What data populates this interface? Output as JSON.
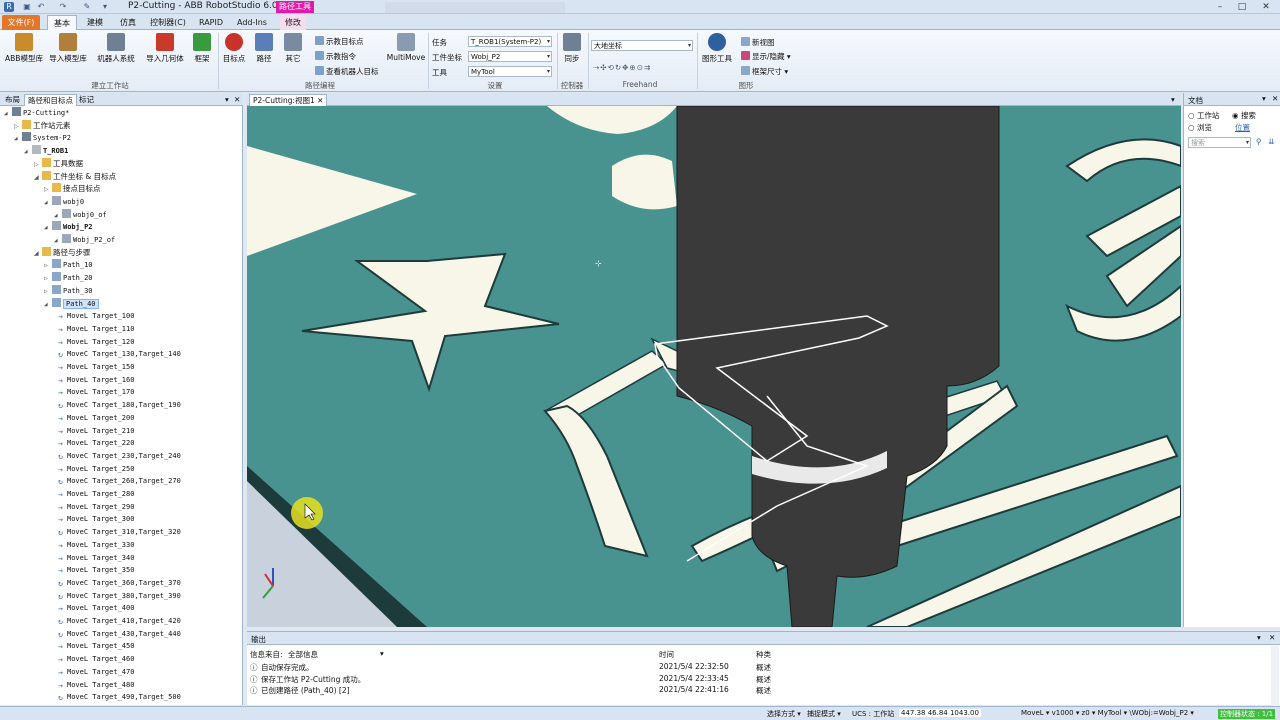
{
  "window": {
    "title": "P2-Cutting - ABB RobotStudio 6.08",
    "context_tab": "路径工具"
  },
  "tabs": [
    "文件(F)",
    "基本",
    "建模",
    "仿真",
    "控制器(C)",
    "RAPID",
    "Add-Ins",
    "修改"
  ],
  "ribbon": {
    "buttons": [
      "ABB模型库",
      "导入模型库",
      "机器人系统",
      "导入几何体",
      "框架",
      "目标点",
      "路径",
      "其它",
      "MultiMove",
      "同步",
      "图形工具"
    ],
    "small_items": [
      "示教目标点",
      "示教指令",
      "查看机器人目标",
      "新视图",
      "显示/隐藏",
      "框架尺寸"
    ],
    "groups": [
      "建立工作站",
      "路径编程",
      "设置",
      "控制器",
      "Freehand",
      "图形"
    ],
    "settings": {
      "task_label": "任务",
      "task_value": "T_ROB1(System-P2)",
      "wobj_label": "工件坐标",
      "wobj_value": "Wobj_P2",
      "tool_label": "工具",
      "tool_value": "MyTool",
      "coord_value": "大地坐标"
    }
  },
  "left_panel": {
    "tabs": [
      "布局",
      "路径和目标点",
      "标记"
    ],
    "tree_top": [
      {
        "text": "P2-Cutting*",
        "level": 0
      },
      {
        "text": "工作站元素",
        "level": 1
      },
      {
        "text": "System-P2",
        "level": 1
      },
      {
        "text": "T_ROB1",
        "level": 2,
        "bold": true
      },
      {
        "text": "工具数据",
        "level": 3
      },
      {
        "text": "工件坐标 & 目标点",
        "level": 3
      },
      {
        "text": "接点目标点",
        "level": 4
      },
      {
        "text": "wobj0",
        "level": 4
      },
      {
        "text": "wobj0_of",
        "level": 5
      },
      {
        "text": "Wobj_P2",
        "level": 4,
        "bold": true
      },
      {
        "text": "Wobj_P2_of",
        "level": 5
      },
      {
        "text": "路径与步骤",
        "level": 3
      },
      {
        "text": "Path_10",
        "level": 4
      },
      {
        "text": "Path_20",
        "level": 4
      },
      {
        "text": "Path_30",
        "level": 4
      },
      {
        "text": "Path_40",
        "level": 4,
        "selected": true
      }
    ],
    "moves": [
      "MoveL Target_100",
      "MoveL Target_110",
      "MoveL Target_120",
      "MoveC Target_130,Target_140",
      "MoveL Target_150",
      "MoveL Target_160",
      "MoveL Target_170",
      "MoveC Target_180,Target_190",
      "MoveL Target_200",
      "MoveL Target_210",
      "MoveL Target_220",
      "MoveC Target_230,Target_240",
      "MoveL Target_250",
      "MoveC Target_260,Target_270",
      "MoveL Target_280",
      "MoveL Target_290",
      "MoveL Target_300",
      "MoveC Target_310,Target_320",
      "MoveL Target_330",
      "MoveL Target_340",
      "MoveL Target_350",
      "MoveC Target_360,Target_370",
      "MoveC Target_380,Target_390",
      "MoveL Target_400",
      "MoveC Target_410,Target_420",
      "MoveC Target_430,Target_440",
      "MoveL Target_450",
      "MoveL Target_460",
      "MoveL Target_470",
      "MoveL Target_480",
      "MoveC Target_490,Target_500"
    ]
  },
  "viewport": {
    "tab": "P2-Cutting:视图1"
  },
  "doc_panel": {
    "title": "文档",
    "radio_station": "工作站",
    "radio_search": "搜索",
    "radio_browse": "浏览",
    "link_location": "位置",
    "search_placeholder": "搜索"
  },
  "output": {
    "title": "输出",
    "source_label": "信息来自:",
    "source_value": "全部信息",
    "col_time": "时间",
    "col_type": "种类",
    "rows": [
      {
        "msg": "自动保存完成。",
        "time": "2021/5/4 22:32:50",
        "type": "概述"
      },
      {
        "msg": "保存工作站 P2-Cutting 成功。",
        "time": "2021/5/4 22:33:45",
        "type": "概述"
      },
      {
        "msg": "已创建路径 (Path_40) [2]",
        "time": "2021/5/4 22:41:16",
        "type": "概述"
      }
    ]
  },
  "status": {
    "select_mode": "选择方式 ▾",
    "snap_mode": "捕捉模式 ▾",
    "ucs": "UCS : 工作站",
    "coords": "447.38   46.84   1043.00",
    "instr": "MoveL ▾  v1000 ▾  z0 ▾  MyTool ▾  \\WObj:=Wobj_P2 ▾",
    "controller_status": "控制器状态 : 1/1"
  },
  "colors": {
    "board": "#489290",
    "letters": "#f8f6e8",
    "tool": "#3a3a3a",
    "accent": "#e4762a"
  }
}
